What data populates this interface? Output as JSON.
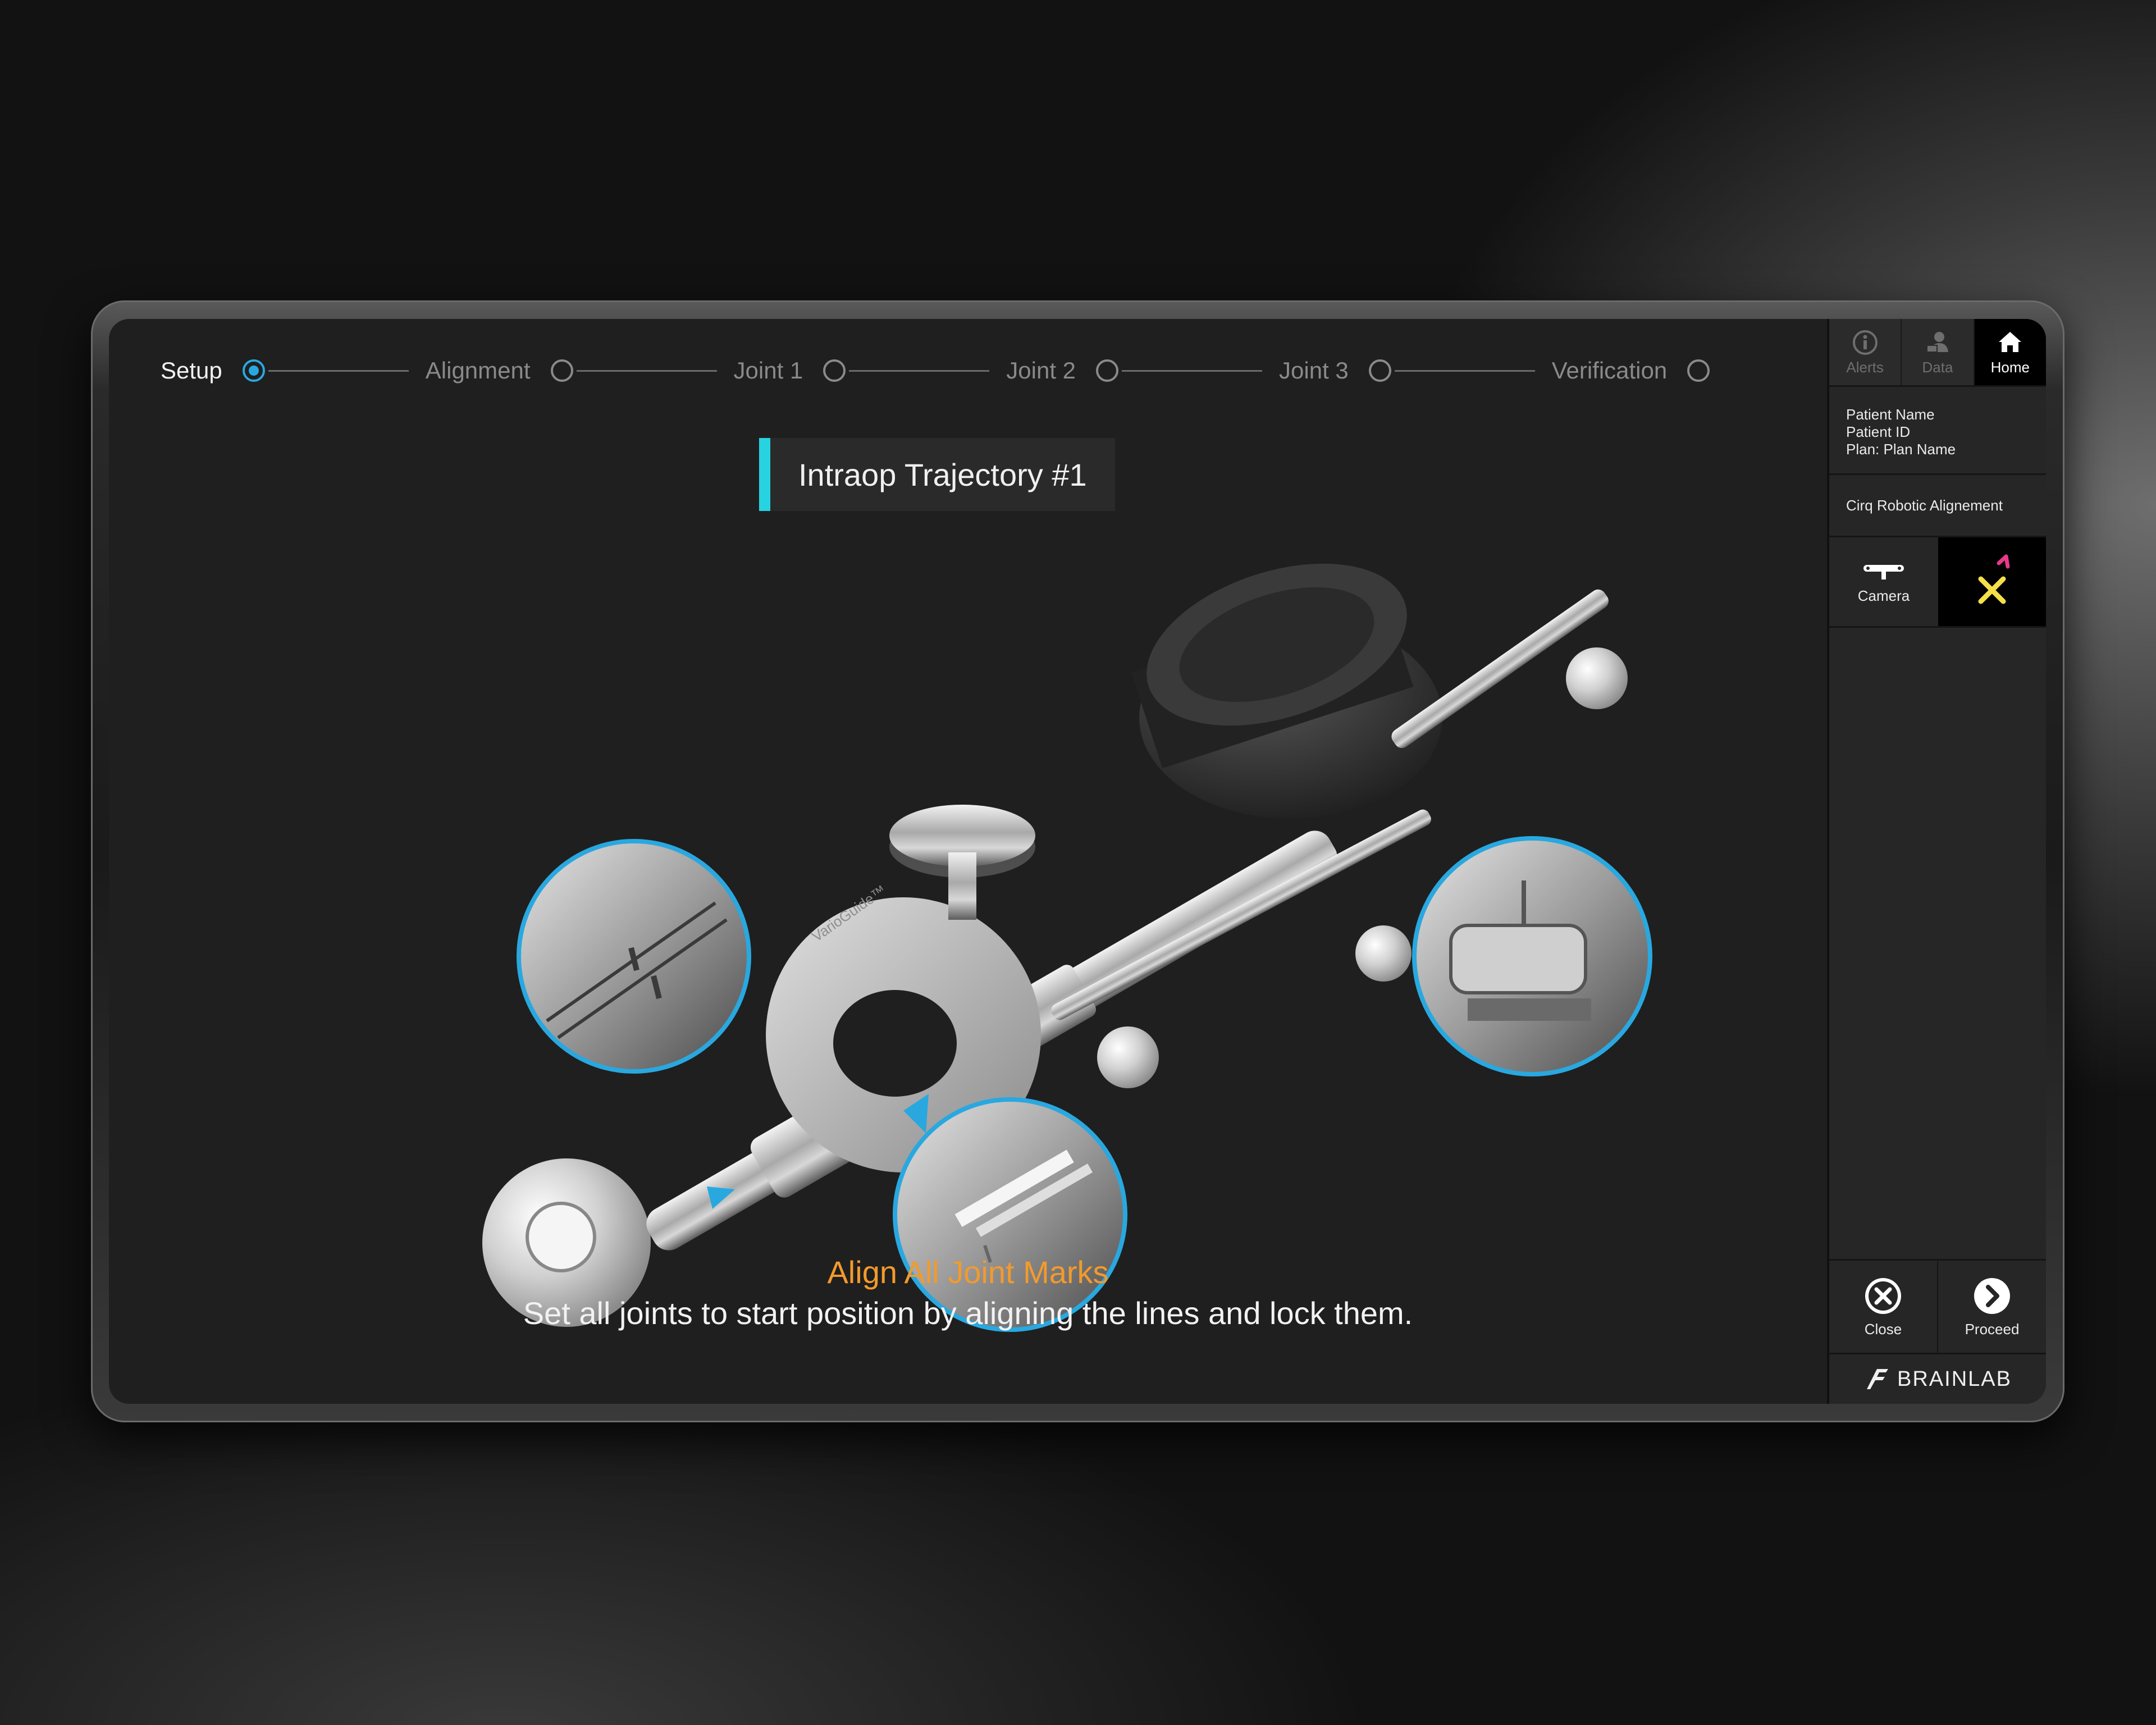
{
  "steps": [
    {
      "label": "Setup",
      "active": true
    },
    {
      "label": "Alignment",
      "active": false
    },
    {
      "label": "Joint 1",
      "active": false
    },
    {
      "label": "Joint 2",
      "active": false
    },
    {
      "label": "Joint 3",
      "active": false
    },
    {
      "label": "Verification",
      "active": false
    }
  ],
  "trajectory_tag": "Intraop Trajectory #1",
  "illustration": {
    "ring_label": "VarioGuide™"
  },
  "instruction": {
    "title": "Align All Joint Marks",
    "body": "Set all joints to start position by aligning the lines and lock them."
  },
  "sidebar": {
    "topnav": {
      "alerts": "Alerts",
      "data": "Data",
      "home": "Home"
    },
    "patient": {
      "name": "Patient Name",
      "id": "Patient ID",
      "plan": "Plan: Plan Name"
    },
    "procedure": "Cirq Robotic Alignement",
    "camera_label": "Camera",
    "close_label": "Close",
    "proceed_label": "Proceed",
    "brand": "BRAINLAB"
  },
  "colors": {
    "accent_blue": "#29a8e0",
    "accent_cyan": "#27d3e0",
    "instruction_orange": "#f39a2c",
    "tracker_yellow": "#f5e04a",
    "tracker_pink": "#e8388a"
  }
}
